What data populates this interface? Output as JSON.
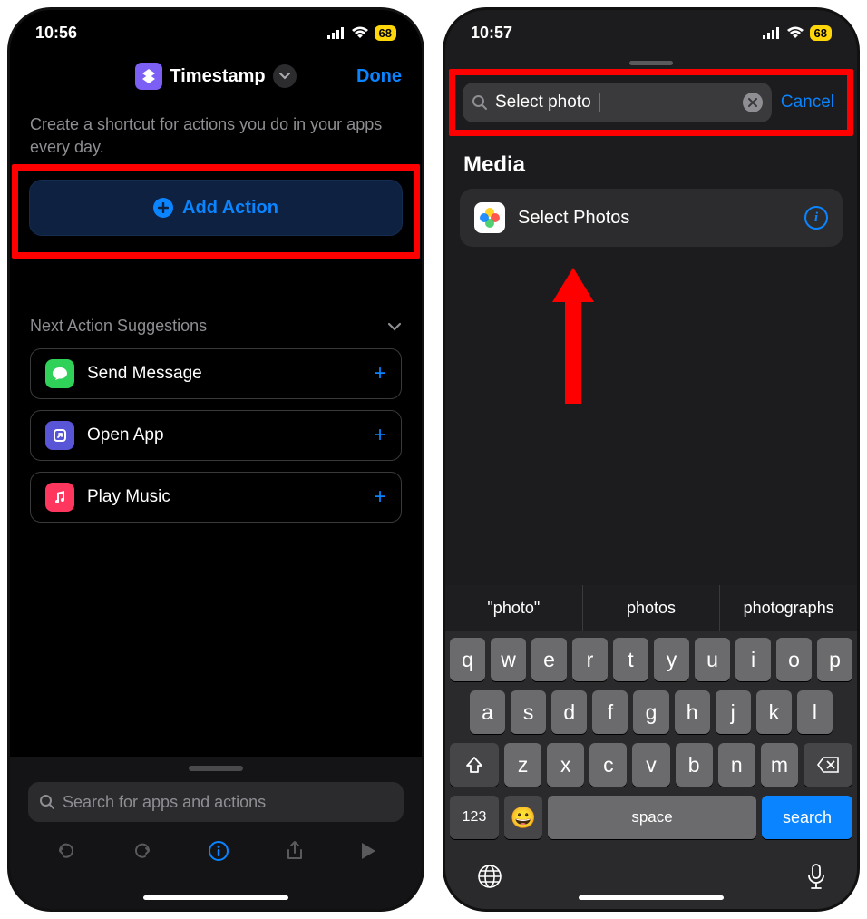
{
  "left": {
    "status": {
      "time": "10:56",
      "battery": "68"
    },
    "header": {
      "title": "Timestamp",
      "done": "Done"
    },
    "description": "Create a shortcut for actions you do in your apps every day.",
    "add_action_label": "Add Action",
    "suggestions_title": "Next Action Suggestions",
    "suggestions": [
      {
        "label": "Send Message",
        "icon_bg": "#30d158",
        "glyph": "💬"
      },
      {
        "label": "Open App",
        "icon_bg": "#5856d6",
        "glyph": "▢"
      },
      {
        "label": "Play Music",
        "icon_bg": "#ff375f",
        "glyph": "♪"
      }
    ],
    "search_placeholder": "Search for apps and actions"
  },
  "right": {
    "status": {
      "time": "10:57",
      "battery": "68"
    },
    "search_value": "Select photo",
    "cancel_label": "Cancel",
    "section_title": "Media",
    "result_label": "Select Photos",
    "quicktype": [
      "\"photo\"",
      "photos",
      "photographs"
    ],
    "keyboard": {
      "row1": [
        "q",
        "w",
        "e",
        "r",
        "t",
        "y",
        "u",
        "i",
        "o",
        "p"
      ],
      "row2": [
        "a",
        "s",
        "d",
        "f",
        "g",
        "h",
        "j",
        "k",
        "l"
      ],
      "row3": [
        "z",
        "x",
        "c",
        "v",
        "b",
        "n",
        "m"
      ],
      "numbers_key": "123",
      "space_label": "space",
      "search_label": "search"
    }
  }
}
